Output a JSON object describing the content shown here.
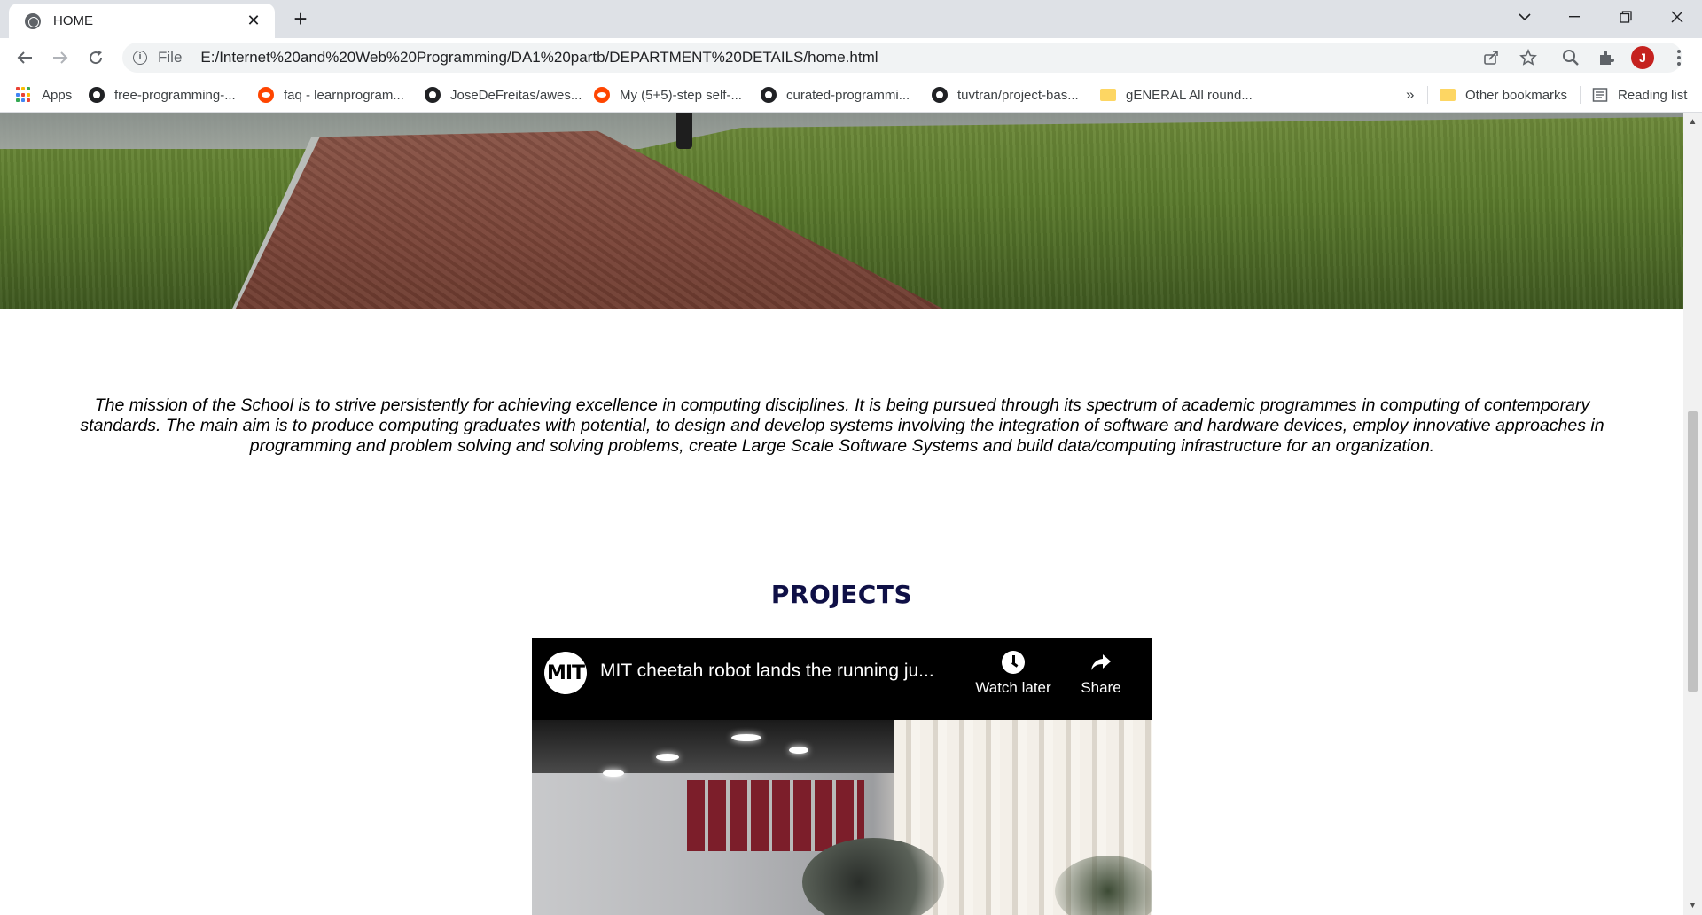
{
  "browser": {
    "tab_title": "HOME",
    "new_tab_label": "+",
    "url_scheme": "File",
    "url": "E:/Internet%20and%20Web%20Programming/DA1%20partb/DEPARTMENT%20DETAILS/home.html",
    "avatar_letter": "J",
    "accent_avatar": "#c5221f"
  },
  "bookmarks": {
    "apps_label": "Apps",
    "items": [
      {
        "label": "free-programming-...",
        "icon": "github-icon"
      },
      {
        "label": "faq - learnprogram...",
        "icon": "reddit-icon"
      },
      {
        "label": "JoseDeFreitas/awes...",
        "icon": "github-icon"
      },
      {
        "label": "My (5+5)-step self-...",
        "icon": "reddit-icon"
      },
      {
        "label": "curated-programmi...",
        "icon": "github-icon"
      },
      {
        "label": "tuvtran/project-bas...",
        "icon": "github-icon"
      },
      {
        "label": "gENERAL All round...",
        "icon": "folder-icon"
      }
    ],
    "overflow_label": "»",
    "other_bookmarks": "Other bookmarks",
    "reading_list": "Reading list"
  },
  "page": {
    "mission_text": "The mission of the School is to strive persistently for achieving excellence in computing disciplines. It is being pursued through its spectrum of academic programmes in computing of contemporary standards. The main aim is to produce computing graduates with potential, to design and develop systems involving the integration of software and hardware devices, employ innovative approaches in programming and problem solving and solving problems, create Large Scale Software Systems and build data/computing infrastructure for an organization.",
    "projects_heading": "PROJECTS",
    "heading_color": "#0f1046",
    "video": {
      "channel_logo_text": "MIT",
      "title": "MIT cheetah robot lands the running ju...",
      "watch_later": "Watch later",
      "share": "Share"
    }
  }
}
